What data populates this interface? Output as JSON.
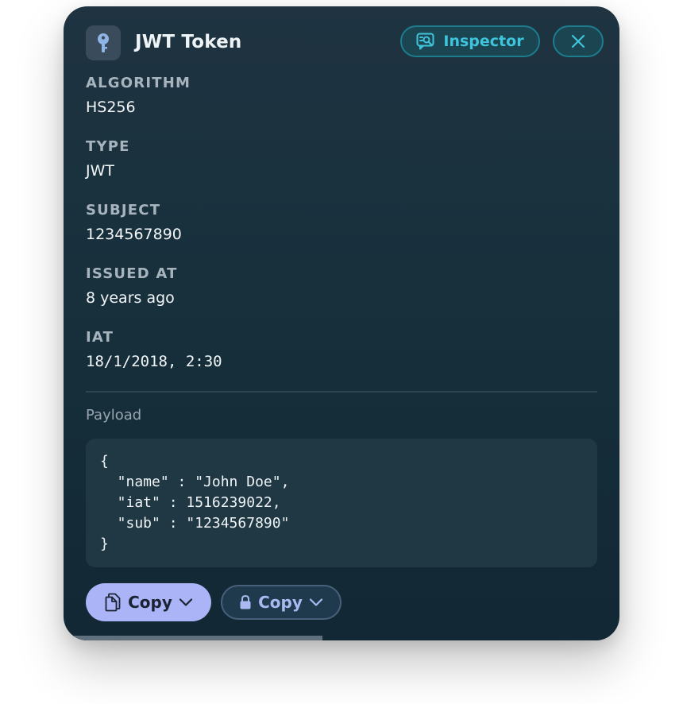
{
  "header": {
    "title": "JWT Token",
    "inspector_label": "Inspector",
    "icons": {
      "app": "key-icon",
      "inspector": "inspector-icon",
      "close": "close-icon"
    }
  },
  "fields": [
    {
      "label": "ALGORITHM",
      "value": "HS256"
    },
    {
      "label": "TYPE",
      "value": "JWT"
    },
    {
      "label": "SUBJECT",
      "value": "1234567890"
    },
    {
      "label": "ISSUED AT",
      "value": "8 years ago"
    },
    {
      "label": "IAT",
      "value": "18/1/2018, 2:30"
    }
  ],
  "payload": {
    "label": "Payload",
    "lines": [
      "{",
      "  \"name\" : \"John Doe\",",
      "  \"iat\" : 1516239022,",
      "  \"sub\" : \"1234567890\"",
      "}"
    ]
  },
  "actions": {
    "copy_label": "Copy",
    "copy_secure_label": "Copy"
  },
  "colors": {
    "accent": "#3fc4dc",
    "primary_button": "#aab4f7",
    "panel_bg": "#17303c"
  }
}
